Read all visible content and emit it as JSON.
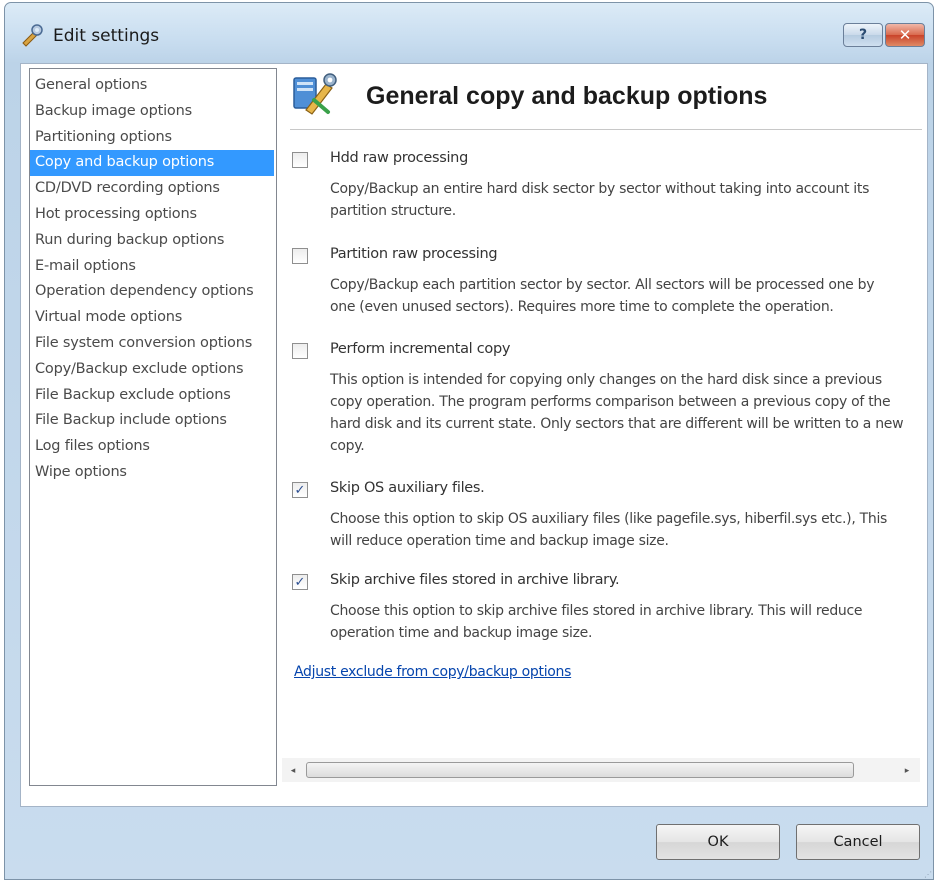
{
  "window": {
    "title": "Edit settings",
    "icon": "settings-wrench-icon",
    "help_label": "?",
    "close_label": "✕"
  },
  "nav": {
    "items": [
      {
        "label": "General options",
        "selected": false
      },
      {
        "label": "Backup image options",
        "selected": false
      },
      {
        "label": "Partitioning options",
        "selected": false
      },
      {
        "label": "Copy and backup options",
        "selected": true
      },
      {
        "label": "CD/DVD recording options",
        "selected": false
      },
      {
        "label": "Hot processing options",
        "selected": false
      },
      {
        "label": "Run during backup options",
        "selected": false
      },
      {
        "label": "E-mail options",
        "selected": false
      },
      {
        "label": "Operation dependency options",
        "selected": false
      },
      {
        "label": "Virtual mode options",
        "selected": false
      },
      {
        "label": "File system conversion options",
        "selected": false
      },
      {
        "label": "Copy/Backup exclude options",
        "selected": false
      },
      {
        "label": "File Backup exclude options",
        "selected": false
      },
      {
        "label": "File Backup include options",
        "selected": false
      },
      {
        "label": "Log files options",
        "selected": false
      },
      {
        "label": "Wipe options",
        "selected": false
      }
    ]
  },
  "main": {
    "title": "General copy and backup options",
    "icon": "settings-tools-icon",
    "options": [
      {
        "label": "Hdd raw processing",
        "checked": false,
        "description": [
          "Copy/Backup an entire hard disk sector by sector without taking into account its",
          "partition structure."
        ]
      },
      {
        "label": "Partition raw processing",
        "checked": false,
        "description": [
          "Copy/Backup each partition sector by sector. All sectors will be processed one by",
          "one (even unused sectors). Requires more time to complete the operation."
        ]
      },
      {
        "label": "Perform incremental copy",
        "checked": false,
        "description": [
          "This option is intended for copying only changes on the hard disk since a previous",
          "copy operation. The program performs comparison between a previous copy of the",
          "hard disk and its current state. Only sectors that are different will be written to a new",
          "copy."
        ]
      },
      {
        "label": "Skip OS auxiliary files.",
        "checked": true,
        "description": [
          "Choose this option to skip OS auxiliary files (like pagefile.sys, hiberfil.sys etc.), This",
          "will reduce operation time and backup image size."
        ]
      },
      {
        "label": "Skip archive files stored in archive library.",
        "checked": true,
        "description": [
          "Choose this option to skip archive files stored in archive library. This will reduce",
          "operation time and backup image size."
        ]
      }
    ],
    "link": "Adjust exclude from copy/backup options"
  },
  "scrollbar": {
    "left_arrow": "◂",
    "right_arrow": "▸"
  },
  "buttons": {
    "ok": "OK",
    "cancel": "Cancel"
  }
}
